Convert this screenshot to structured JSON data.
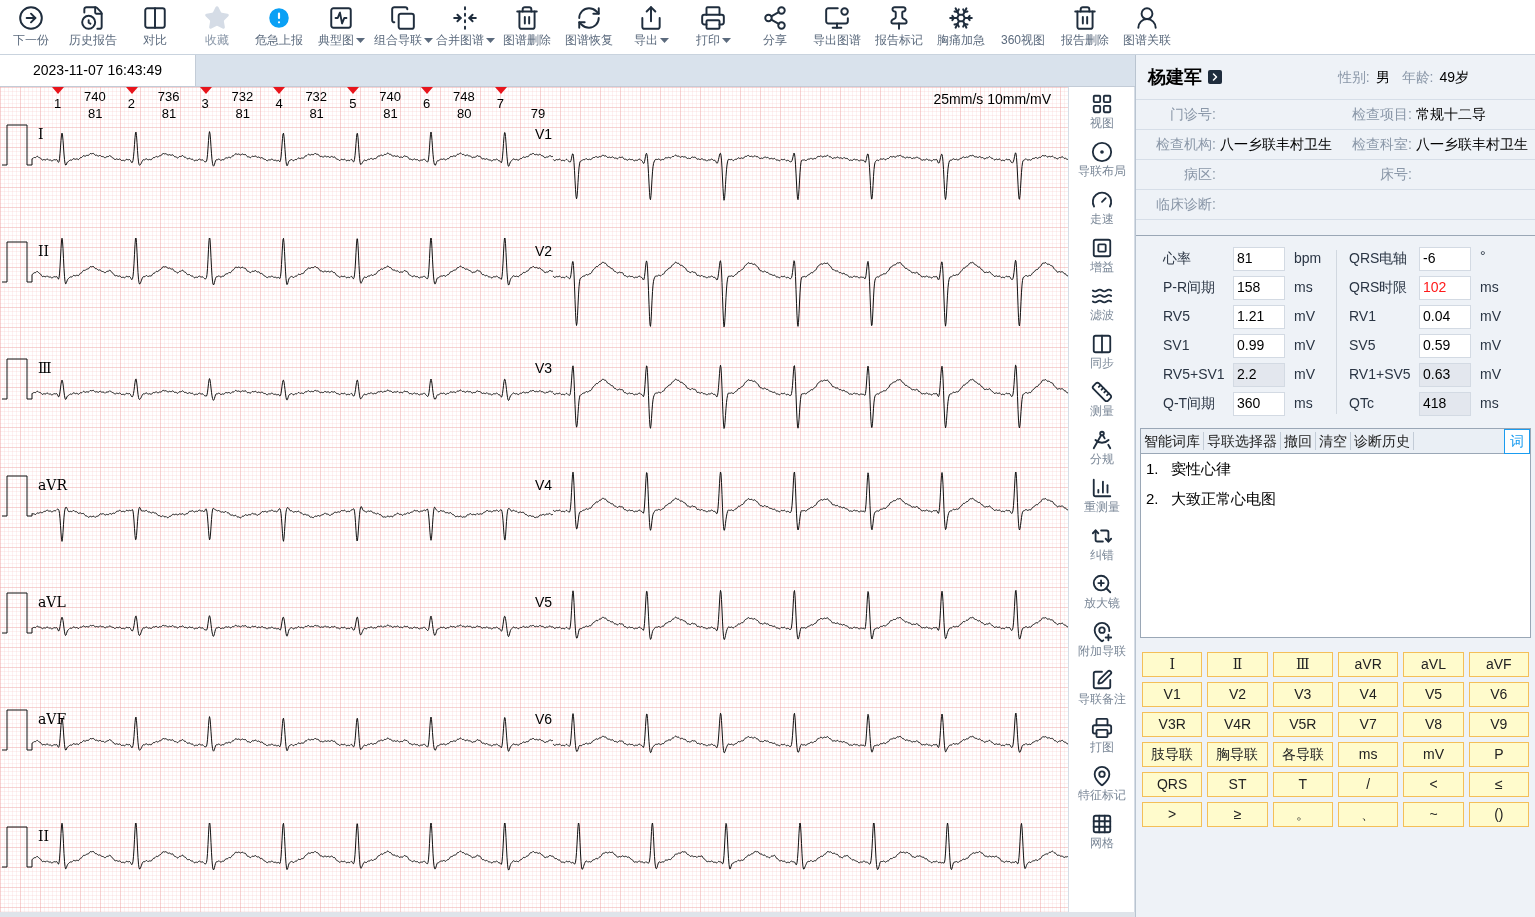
{
  "toolbar": [
    {
      "label": "下一份",
      "dropdown": false,
      "disabled": false
    },
    {
      "label": "历史报告",
      "dropdown": false,
      "disabled": false
    },
    {
      "label": "对比",
      "dropdown": false,
      "disabled": false
    },
    {
      "label": "收藏",
      "dropdown": false,
      "disabled": true
    },
    {
      "label": "危急上报",
      "dropdown": false,
      "disabled": false
    },
    {
      "label": "典型图",
      "dropdown": true,
      "disabled": false
    },
    {
      "label": "组合导联",
      "dropdown": true,
      "disabled": false
    },
    {
      "label": "合并图谱",
      "dropdown": true,
      "disabled": false
    },
    {
      "label": "图谱删除",
      "dropdown": false,
      "disabled": false
    },
    {
      "label": "图谱恢复",
      "dropdown": false,
      "disabled": false
    },
    {
      "label": "导出",
      "dropdown": true,
      "disabled": false
    },
    {
      "label": "打印",
      "dropdown": true,
      "disabled": false
    },
    {
      "label": "分享",
      "dropdown": false,
      "disabled": false
    },
    {
      "label": "导出图谱",
      "dropdown": false,
      "disabled": false
    },
    {
      "label": "报告标记",
      "dropdown": false,
      "disabled": false
    },
    {
      "label": "胸痛加急",
      "dropdown": false,
      "disabled": false
    },
    {
      "label": "360视图",
      "dropdown": false,
      "disabled": false
    },
    {
      "label": "报告删除",
      "dropdown": false,
      "disabled": false
    },
    {
      "label": "图谱关联",
      "dropdown": false,
      "disabled": false
    }
  ],
  "record_tabs": [
    {
      "label": "2023-11-07 16:43:49",
      "selected": true
    }
  ],
  "ecg": {
    "speed": "25mm/s 10mm/mV",
    "beats": [
      "1",
      "2",
      "3",
      "4",
      "5",
      "6",
      "7"
    ],
    "intervals": [
      {
        "rr": "740",
        "hr": "81"
      },
      {
        "rr": "736",
        "hr": "81"
      },
      {
        "rr": "732",
        "hr": "81"
      },
      {
        "rr": "732",
        "hr": "81"
      },
      {
        "rr": "740",
        "hr": "81"
      },
      {
        "rr": "748",
        "hr": "80"
      },
      {
        "hr": "79"
      }
    ],
    "rows": [
      {
        "left": "I",
        "right": "V1"
      },
      {
        "left": "II",
        "right": "V2"
      },
      {
        "left": "Ⅲ",
        "right": "V3"
      },
      {
        "left": "aVR",
        "right": "V4"
      },
      {
        "left": "aVL",
        "right": "V5"
      },
      {
        "left": "aVF",
        "right": "V6"
      },
      {
        "left": "II"
      }
    ]
  },
  "side_tools": [
    "视图",
    "导联布局",
    "走速",
    "增益",
    "滤波",
    "同步",
    "测量",
    "分规",
    "重测量",
    "纠错",
    "放大镜",
    "附加导联",
    "导联备注",
    "打图",
    "特征标记",
    "网格"
  ],
  "patient": {
    "name": "杨建军",
    "sex_label": "性别:",
    "sex": "男",
    "age_label": "年龄:",
    "age": "49岁"
  },
  "info_rows": [
    [
      {
        "label": "门诊号:"
      },
      {
        "label": "检查项目:",
        "value": "常规十二导"
      }
    ],
    [
      {
        "label": "检查机构:",
        "value": "八一乡联丰村卫生"
      },
      {
        "label": "检查科室:",
        "value": "八一乡联丰村卫生"
      }
    ],
    [
      {
        "label": "病区:"
      },
      {
        "label": "床号:"
      }
    ],
    [
      {
        "label": "临床诊断:"
      }
    ]
  ],
  "measurements": [
    {
      "label": "心率",
      "value": "81",
      "unit": "bpm",
      "readonly": false,
      "alert": false
    },
    {
      "label": "QRS电轴",
      "value": "-6",
      "unit": "°",
      "readonly": false,
      "alert": false
    },
    {
      "label": "P-R间期",
      "value": "158",
      "unit": "ms",
      "readonly": false,
      "alert": false
    },
    {
      "label": "QRS时限",
      "value": "102",
      "unit": "ms",
      "readonly": false,
      "alert": true
    },
    {
      "label": "RV5",
      "value": "1.21",
      "unit": "mV",
      "readonly": false,
      "alert": false
    },
    {
      "label": "RV1",
      "value": "0.04",
      "unit": "mV",
      "readonly": false,
      "alert": false
    },
    {
      "label": "SV1",
      "value": "0.99",
      "unit": "mV",
      "readonly": false,
      "alert": false
    },
    {
      "label": "SV5",
      "value": "0.59",
      "unit": "mV",
      "readonly": false,
      "alert": false
    },
    {
      "label": "RV5+SV1",
      "value": "2.2",
      "unit": "mV",
      "readonly": true,
      "alert": false
    },
    {
      "label": "RV1+SV5",
      "value": "0.63",
      "unit": "mV",
      "readonly": true,
      "alert": false
    },
    {
      "label": "Q-T间期",
      "value": "360",
      "unit": "ms",
      "readonly": false,
      "alert": false
    },
    {
      "label": "QTc",
      "value": "418",
      "unit": "ms",
      "readonly": true,
      "alert": false
    }
  ],
  "diagnosis_tools": [
    "智能词库",
    "导联选择器",
    "撤回",
    "清空",
    "诊断历史"
  ],
  "word_button": {
    "label": "词",
    "selected": true
  },
  "diagnoses": [
    {
      "number": "1.",
      "text": "窦性心律"
    },
    {
      "number": "2.",
      "text": "大致正常心电图"
    }
  ],
  "keypad": [
    "I",
    "Ⅱ",
    "Ⅲ",
    "aVR",
    "aVL",
    "aVF",
    "V1",
    "V2",
    "V3",
    "V4",
    "V5",
    "V6",
    "V3R",
    "V4R",
    "V5R",
    "V7",
    "V8",
    "V9",
    "肢导联",
    "胸导联",
    "各导联",
    "ms",
    "mV",
    "P",
    "QRS",
    "ST",
    "T",
    "/",
    "<",
    "≤",
    ">",
    "≥",
    "。",
    "、",
    "~",
    "()"
  ]
}
